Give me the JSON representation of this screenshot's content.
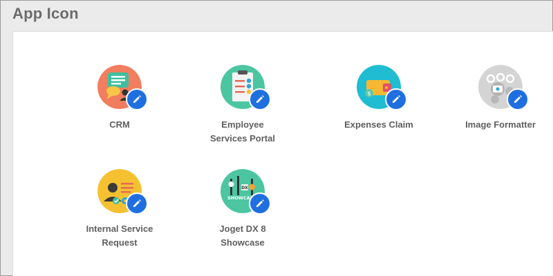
{
  "page": {
    "title": "App Icon"
  },
  "apps": [
    {
      "line1": "CRM",
      "line2": "",
      "icon": "crm-chat-icon",
      "color": "#f27d5f"
    },
    {
      "line1": "Employee",
      "line2": "Services Portal",
      "icon": "clipboard-checklist-icon",
      "color": "#4cc6a0"
    },
    {
      "line1": "Expenses Claim",
      "line2": "",
      "icon": "wallet-icon",
      "color": "#1fbcd2"
    },
    {
      "line1": "Image Formatter",
      "line2": "",
      "icon": "image-gears-icon",
      "color": "#cfcfcf"
    },
    {
      "line1": "Internal Service",
      "line2": "Request",
      "icon": "user-service-icon",
      "color": "#f5c131"
    },
    {
      "line1": "Joget DX 8",
      "line2": "Showcase",
      "icon": "showcase-sliders-icon",
      "color": "#4cc6a0"
    }
  ],
  "edit_badge": {
    "icon": "pencil-icon",
    "color": "#1f6fe0"
  },
  "showcase_text": {
    "dx": "DX",
    "showcase": "SHOWCASE"
  }
}
